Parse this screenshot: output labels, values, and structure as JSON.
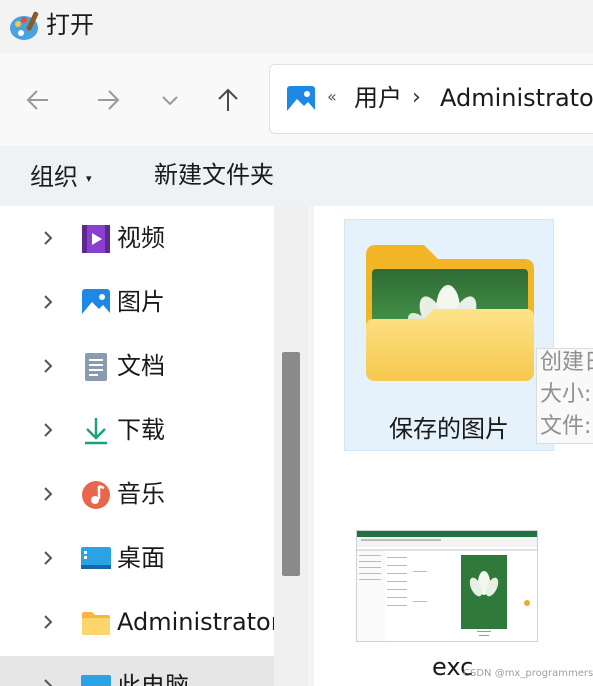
{
  "window": {
    "title": "打开",
    "app_icon": "paint-palette-icon"
  },
  "nav": {
    "back_icon": "arrow-left-icon",
    "forward_icon": "arrow-right-icon",
    "recent_icon": "chevron-down-icon",
    "up_icon": "arrow-up-icon"
  },
  "address": {
    "icon": "pictures-icon",
    "overflow": "«",
    "segments": [
      "用户",
      "Administrator"
    ],
    "separator": "›"
  },
  "toolbar": {
    "organize_label": "组织",
    "organize_caret": "▾",
    "new_folder_label": "新建文件夹"
  },
  "sidebar": {
    "items": [
      {
        "label": "视频",
        "icon": "videos-icon"
      },
      {
        "label": "图片",
        "icon": "pictures-icon"
      },
      {
        "label": "文档",
        "icon": "documents-icon"
      },
      {
        "label": "下载",
        "icon": "downloads-icon"
      },
      {
        "label": "音乐",
        "icon": "music-icon"
      },
      {
        "label": "桌面",
        "icon": "desktop-icon"
      },
      {
        "label": "Administrator",
        "icon": "folder-icon"
      },
      {
        "label": "此电脑",
        "icon": "this-pc-icon",
        "selected": true
      }
    ]
  },
  "files": [
    {
      "name": "保存的图片",
      "type": "folder",
      "selected": true
    },
    {
      "name": "exc",
      "type": "excel-thumbnail"
    }
  ],
  "tooltip": {
    "lines": [
      "创建日",
      "大小:",
      "文件:"
    ]
  },
  "watermark": "CSDN @mx_programmers",
  "colors": {
    "accent": "#0067c0",
    "selection": "#e5f1fb",
    "folder": "#f8c93c"
  }
}
